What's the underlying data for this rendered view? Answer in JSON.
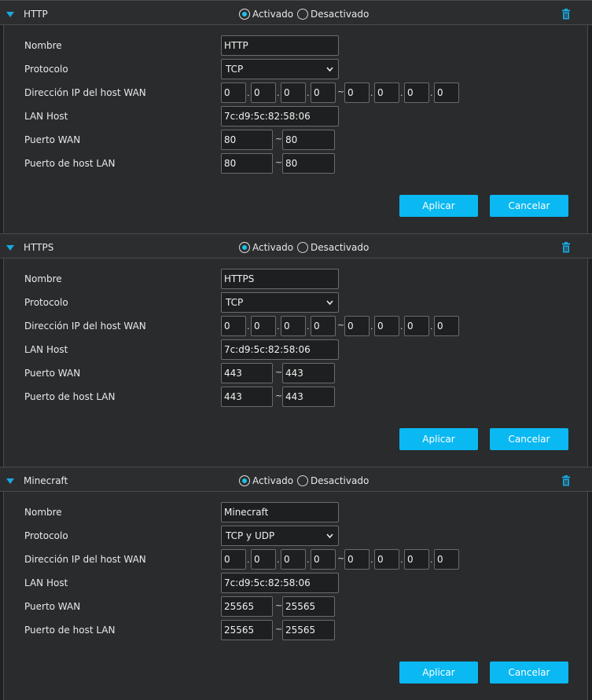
{
  "status_on": "Activado",
  "status_off": "Desactivado",
  "labels": {
    "name": "Nombre",
    "protocol": "Protocolo",
    "wan_ip": "Dirección IP del host WAN",
    "lan_host": "LAN Host",
    "wan_port": "Puerto WAN",
    "lan_port": "Puerto de host LAN"
  },
  "buttons": {
    "apply": "Aplicar",
    "cancel": "Cancelar"
  },
  "ip_separator_dot": ".",
  "range_separator": "~",
  "accent_color": "#0ab8f2",
  "rules": [
    {
      "title": "HTTP",
      "enabled": true,
      "name": "HTTP",
      "protocol": "TCP",
      "wan_ip_start": [
        "0",
        "0",
        "0",
        "0"
      ],
      "wan_ip_end": [
        "0",
        "0",
        "0",
        "0"
      ],
      "lan_host": "7c:d9:5c:82:58:06",
      "wan_port_start": "80",
      "wan_port_end": "80",
      "lan_port_start": "80",
      "lan_port_end": "80"
    },
    {
      "title": "HTTPS",
      "enabled": true,
      "name": "HTTPS",
      "protocol": "TCP",
      "wan_ip_start": [
        "0",
        "0",
        "0",
        "0"
      ],
      "wan_ip_end": [
        "0",
        "0",
        "0",
        "0"
      ],
      "lan_host": "7c:d9:5c:82:58:06",
      "wan_port_start": "443",
      "wan_port_end": "443",
      "lan_port_start": "443",
      "lan_port_end": "443"
    },
    {
      "title": "Minecraft",
      "enabled": true,
      "name": "Minecraft",
      "protocol": "TCP y UDP",
      "wan_ip_start": [
        "0",
        "0",
        "0",
        "0"
      ],
      "wan_ip_end": [
        "0",
        "0",
        "0",
        "0"
      ],
      "lan_host": "7c:d9:5c:82:58:06",
      "wan_port_start": "25565",
      "wan_port_end": "25565",
      "lan_port_start": "25565",
      "lan_port_end": "25565"
    }
  ]
}
